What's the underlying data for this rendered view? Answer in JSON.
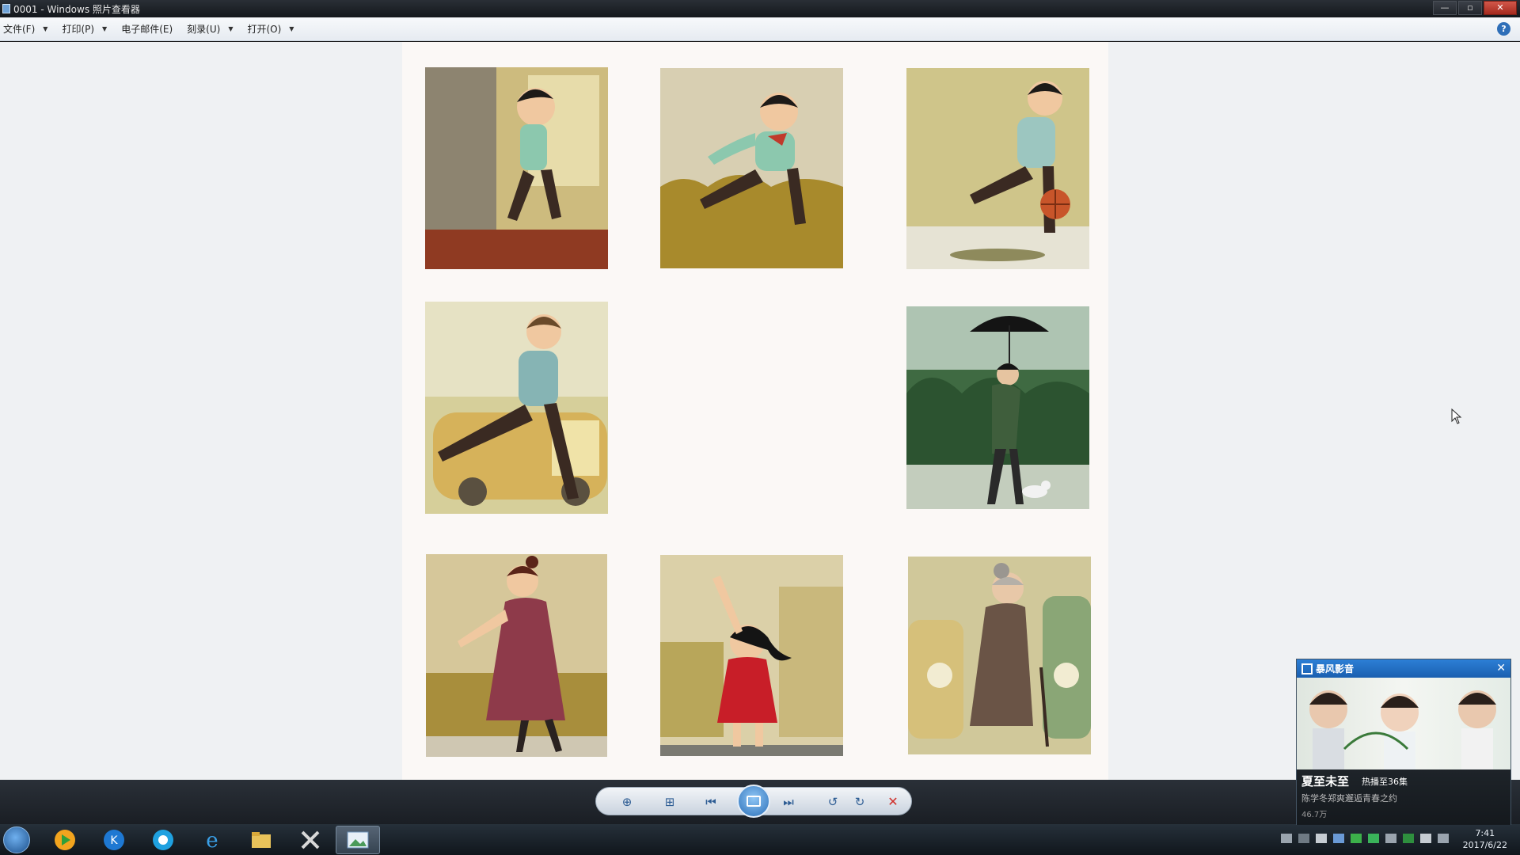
{
  "window": {
    "title": "0001 - Windows 照片查看器",
    "controls": {
      "minimize": "—",
      "maximize": "▫",
      "close": "✕"
    }
  },
  "menu": {
    "items": [
      {
        "label": "文件(F)",
        "has_caret": true
      },
      {
        "label": "打印(P)",
        "has_caret": true
      },
      {
        "label": "电子邮件(E)",
        "has_caret": false
      },
      {
        "label": "刻录(U)",
        "has_caret": true
      },
      {
        "label": "打开(O)",
        "has_caret": true
      }
    ],
    "help_label": "?"
  },
  "illustrations": [
    {
      "name": "boy-running-from-door",
      "desc_icon": "illustration"
    },
    {
      "name": "boy-running-with-red-scarf"
    },
    {
      "name": "boy-dribbling-basketball"
    },
    {
      "name": "boy-running-by-car"
    },
    {
      "name": "old-man-with-umbrella-and-dog"
    },
    {
      "name": "woman-in-red-dress"
    },
    {
      "name": "girl-in-red-dress-reaching"
    },
    {
      "name": "old-woman-with-cane"
    }
  ],
  "controls": {
    "zoom": "⊕",
    "fit": "⊞",
    "prev": "⏮",
    "next": "⏭",
    "rotate_left": "↺",
    "rotate_right": "↻",
    "delete": "✕"
  },
  "taskbar": {
    "clock_time": "7:41",
    "clock_date": "2017/6/22"
  },
  "popup": {
    "brand": "暴风影音",
    "close": "✕",
    "title": "夏至未至",
    "tag": "热播至36集",
    "subtitle": "陈学冬郑爽邂逅青春之约",
    "views": "46.7万"
  },
  "colors": {
    "titlebar": "#1d2228",
    "menubar": "#eef2f6",
    "viewer_bg": "#eff1f3",
    "doc_bg": "#fbf8f6",
    "accent": "#2c7fd6",
    "delete_red": "#d0302a"
  }
}
